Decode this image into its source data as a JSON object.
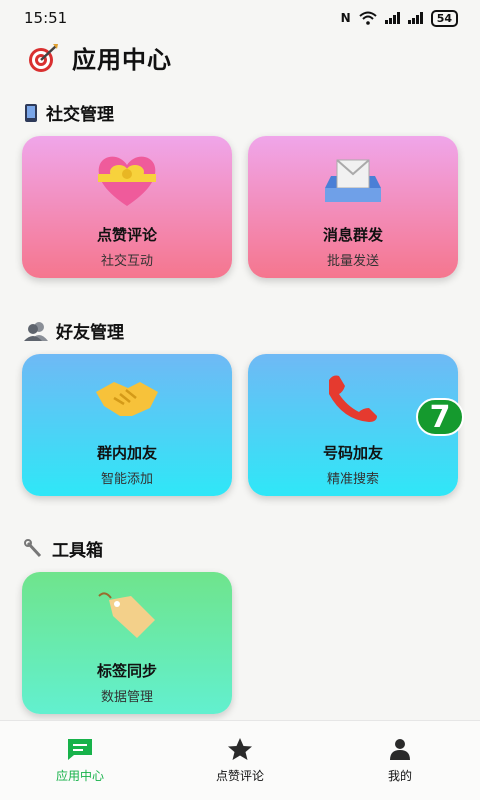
{
  "status_bar": {
    "time": "15:51",
    "battery": "54"
  },
  "header": {
    "title": "应用中心"
  },
  "sections": [
    {
      "title": "社交管理"
    },
    {
      "title": "好友管理"
    },
    {
      "title": "工具箱"
    }
  ],
  "cards": {
    "like_comment": {
      "title": "点赞评论",
      "subtitle": "社交互动"
    },
    "mass_message": {
      "title": "消息群发",
      "subtitle": "批量发送"
    },
    "group_add": {
      "title": "群内加友",
      "subtitle": "智能添加"
    },
    "number_add": {
      "title": "号码加友",
      "subtitle": "精准搜索"
    },
    "tag_sync": {
      "title": "标签同步",
      "subtitle": "数据管理"
    }
  },
  "floating_badge": {
    "value": "7"
  },
  "bottom_nav": [
    {
      "label": "应用中心",
      "icon": "message-square-icon",
      "active": true
    },
    {
      "label": "点赞评论",
      "icon": "star-icon",
      "active": false
    },
    {
      "label": "我的",
      "icon": "person-icon",
      "active": false
    }
  ],
  "colors": {
    "accent": "#17b24a",
    "badge": "#159a2e"
  }
}
